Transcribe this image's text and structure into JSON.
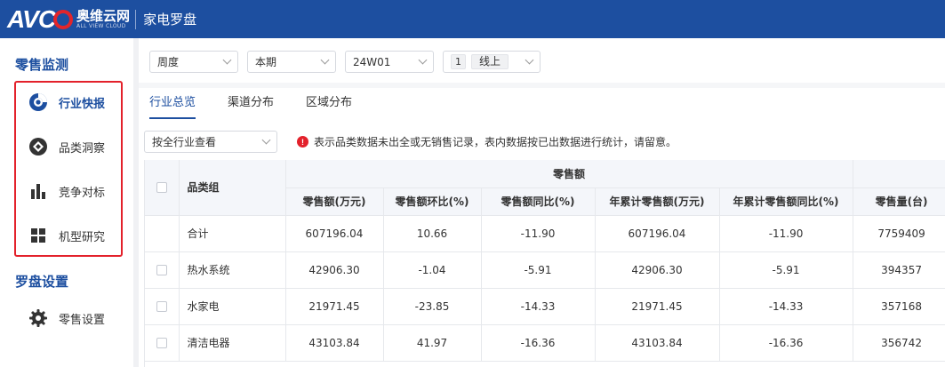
{
  "header": {
    "logo_text": "AVC",
    "logo_cn": "奥维云网",
    "logo_en": "ALL VIEW CLOUD",
    "app_title": "家电罗盘"
  },
  "sidebar": {
    "section1_title": "零售监测",
    "items": [
      {
        "label": "行业快报",
        "icon": "swirl-logo-icon",
        "active": true
      },
      {
        "label": "品类洞察",
        "icon": "aperture-icon",
        "active": false
      },
      {
        "label": "竞争对标",
        "icon": "bar-chart-icon",
        "active": false
      },
      {
        "label": "机型研究",
        "icon": "grid-icon",
        "active": false
      }
    ],
    "section2_title": "罗盘设置",
    "settings_item": {
      "label": "零售设置",
      "icon": "gear-icon"
    }
  },
  "filters": {
    "period_type": "周度",
    "period": "本期",
    "week": "24W01",
    "channel_count": "1",
    "channel": "线上"
  },
  "tabs": [
    {
      "label": "行业总览",
      "active": true
    },
    {
      "label": "渠道分布",
      "active": false
    },
    {
      "label": "区域分布",
      "active": false
    }
  ],
  "view_select": "按全行业查看",
  "notice": "表示品类数据未出全或无销售记录，表内数据按已出数据进行统计，请留意。",
  "table": {
    "group_header": "零售额",
    "row_header": "品类组",
    "columns": [
      "零售额(万元)",
      "零售额环比(%)",
      "零售额同比(%)",
      "年累计零售额(万元)",
      "年累计零售额同比(%)",
      "零售量(台)"
    ],
    "rows": [
      {
        "name": "合计",
        "checkbox": false,
        "values": [
          "607196.04",
          "10.66",
          "-11.90",
          "607196.04",
          "-11.90",
          "7759409"
        ]
      },
      {
        "name": "热水系统",
        "checkbox": true,
        "values": [
          "42906.30",
          "-1.04",
          "-5.91",
          "42906.30",
          "-5.91",
          "394357"
        ]
      },
      {
        "name": "水家电",
        "checkbox": true,
        "values": [
          "21971.45",
          "-23.85",
          "-14.33",
          "21971.45",
          "-14.33",
          "357168"
        ]
      },
      {
        "name": "清洁电器",
        "checkbox": true,
        "values": [
          "43103.84",
          "41.97",
          "-16.36",
          "43103.84",
          "-16.36",
          "356742"
        ]
      }
    ]
  },
  "colors": {
    "brand_blue": "#1d4fa0",
    "highlight_red": "#e3212b"
  }
}
